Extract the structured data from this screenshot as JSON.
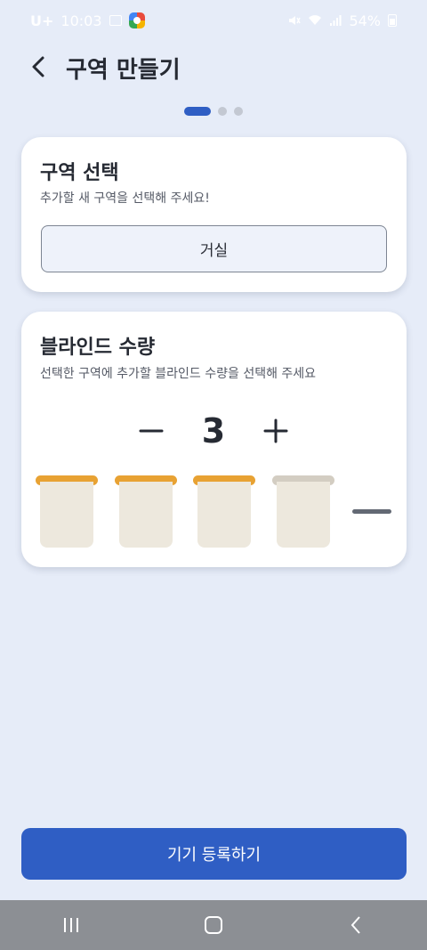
{
  "status_bar": {
    "carrier": "U+",
    "time": "10:03",
    "battery": "54%"
  },
  "header": {
    "title": "구역 만들기"
  },
  "progress": {
    "total_steps": 3,
    "current_step": 1
  },
  "zone_card": {
    "title": "구역 선택",
    "subtitle": "추가할 새 구역을 선택해 주세요!",
    "selected_zone": "거실"
  },
  "blind_card": {
    "title": "블라인드 수량",
    "subtitle": "선택한 구역에 추가할 블라인드 수량을 선택해 주세요",
    "quantity": "3",
    "preview_total": 4,
    "preview_active": 3
  },
  "footer": {
    "primary_button": "기기 등록하기"
  },
  "colors": {
    "accent": "#2f5ec4",
    "blind_rail_active": "#e8a233",
    "blind_rail_inactive": "#d3cdc2",
    "blind_shade": "#ede8dd",
    "background": "#e6ecf8"
  }
}
